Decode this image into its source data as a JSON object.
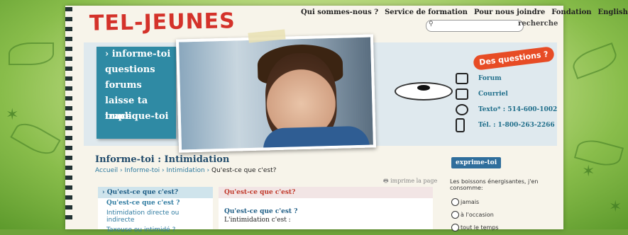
{
  "logo": "TEL-JEUNES",
  "topnav": [
    "Qui sommes-nous ?",
    "Service de formation",
    "Pour nous joindre",
    "Fondation",
    "English"
  ],
  "search": {
    "placeholder": "",
    "button": "recherche"
  },
  "menu": [
    "› informe-toi",
    "questions",
    "forums",
    "laisse ta trace",
    "implique-toi"
  ],
  "banner": {
    "bubble": "Des questions ?",
    "contacts": [
      "Forum",
      "Courriel",
      "Texto* : 514-600-1002",
      "Tél. : 1-800-263-2266"
    ]
  },
  "page": {
    "title": "Informe-toi : Intimidation",
    "breadcrumb": {
      "home": "Accueil",
      "sep": "›",
      "l1": "Informe-toi",
      "l2": "Intimidation",
      "current": "Qu'est-ce que c'est?"
    },
    "print": "imprime la page"
  },
  "leftnav": {
    "header": "› Qu'est-ce que c'est?",
    "items": [
      "Qu'est-ce que c'est ?",
      "Intimidation directe ou indirecte",
      "Taxeuse ou intimidé ?"
    ]
  },
  "main": {
    "header": "Qu'est-ce que c'est?",
    "subtitle": "Qu'est-ce que c'est ?",
    "text": "L'intimidation c'est :"
  },
  "poll": {
    "badge": "exprime-toi",
    "question": "Les boissons énergisantes, j'en consomme:",
    "options": [
      "jamais",
      "à l'occasion",
      "tout le temps"
    ]
  }
}
